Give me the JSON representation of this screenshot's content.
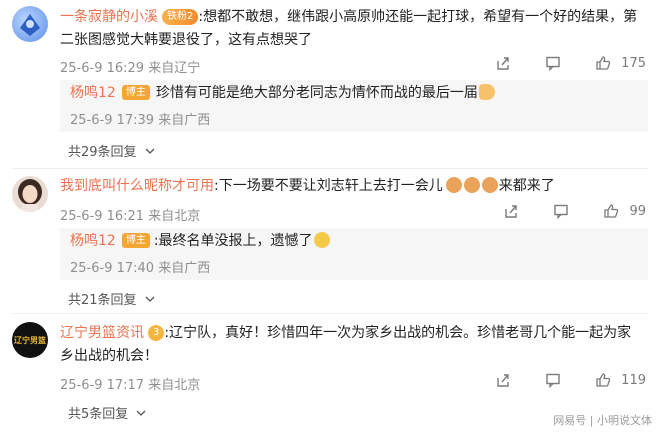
{
  "comments": [
    {
      "username": "一条寂静的小溪",
      "fan_badge": "铁粉2",
      "text": ":想都不敢想，继伟跟小高原帅还能一起打球，希望有一个好的结果，第二张图感觉大韩要退役了，这有点想哭了",
      "meta": "25-6-9 16:29 来自辽宁",
      "likes": "175",
      "reply": {
        "username": "杨鸣12",
        "role": "博主",
        "text": "珍惜有可能是绝大部分老同志为情怀而战的最后一届",
        "meta": "25-6-9 17:39 来自广西"
      },
      "more_replies": "共29条回复"
    },
    {
      "username": "我到底叫什么昵称才可用",
      "text": ":下一场要不要让刘志轩上去打一会儿",
      "text_tail": "来都来了",
      "meta": "25-6-9 16:21 来自北京",
      "likes": "99",
      "reply": {
        "username": "杨鸣12",
        "role": "博主",
        "text": ":最终名单没报上，遗憾了",
        "meta": "25-6-9 17:40 来自广西"
      },
      "more_replies": "共21条回复"
    },
    {
      "username": "辽宁男篮资讯",
      "text": ":辽宁队，真好！珍惜四年一次为家乡出战的机会。珍惜老哥几个能一起为家乡出战的机会！",
      "meta": "25-6-9 17:17 来自北京",
      "likes": "119",
      "more_replies": "共5条回复"
    }
  ],
  "avatar_logo_text": "辽宁男篮",
  "vip_badge": "3",
  "watermark": "网易号 | 小明说文体",
  "colors": {
    "name": "#eb7350",
    "badge": "#f3a536",
    "meta": "#8f8f8f",
    "reply_bg": "#f6f6f6"
  },
  "icons": [
    "share-icon",
    "comment-icon",
    "like-icon",
    "chevron-down-icon",
    "bow-emoji",
    "cat-emoji",
    "cry-emoji"
  ]
}
